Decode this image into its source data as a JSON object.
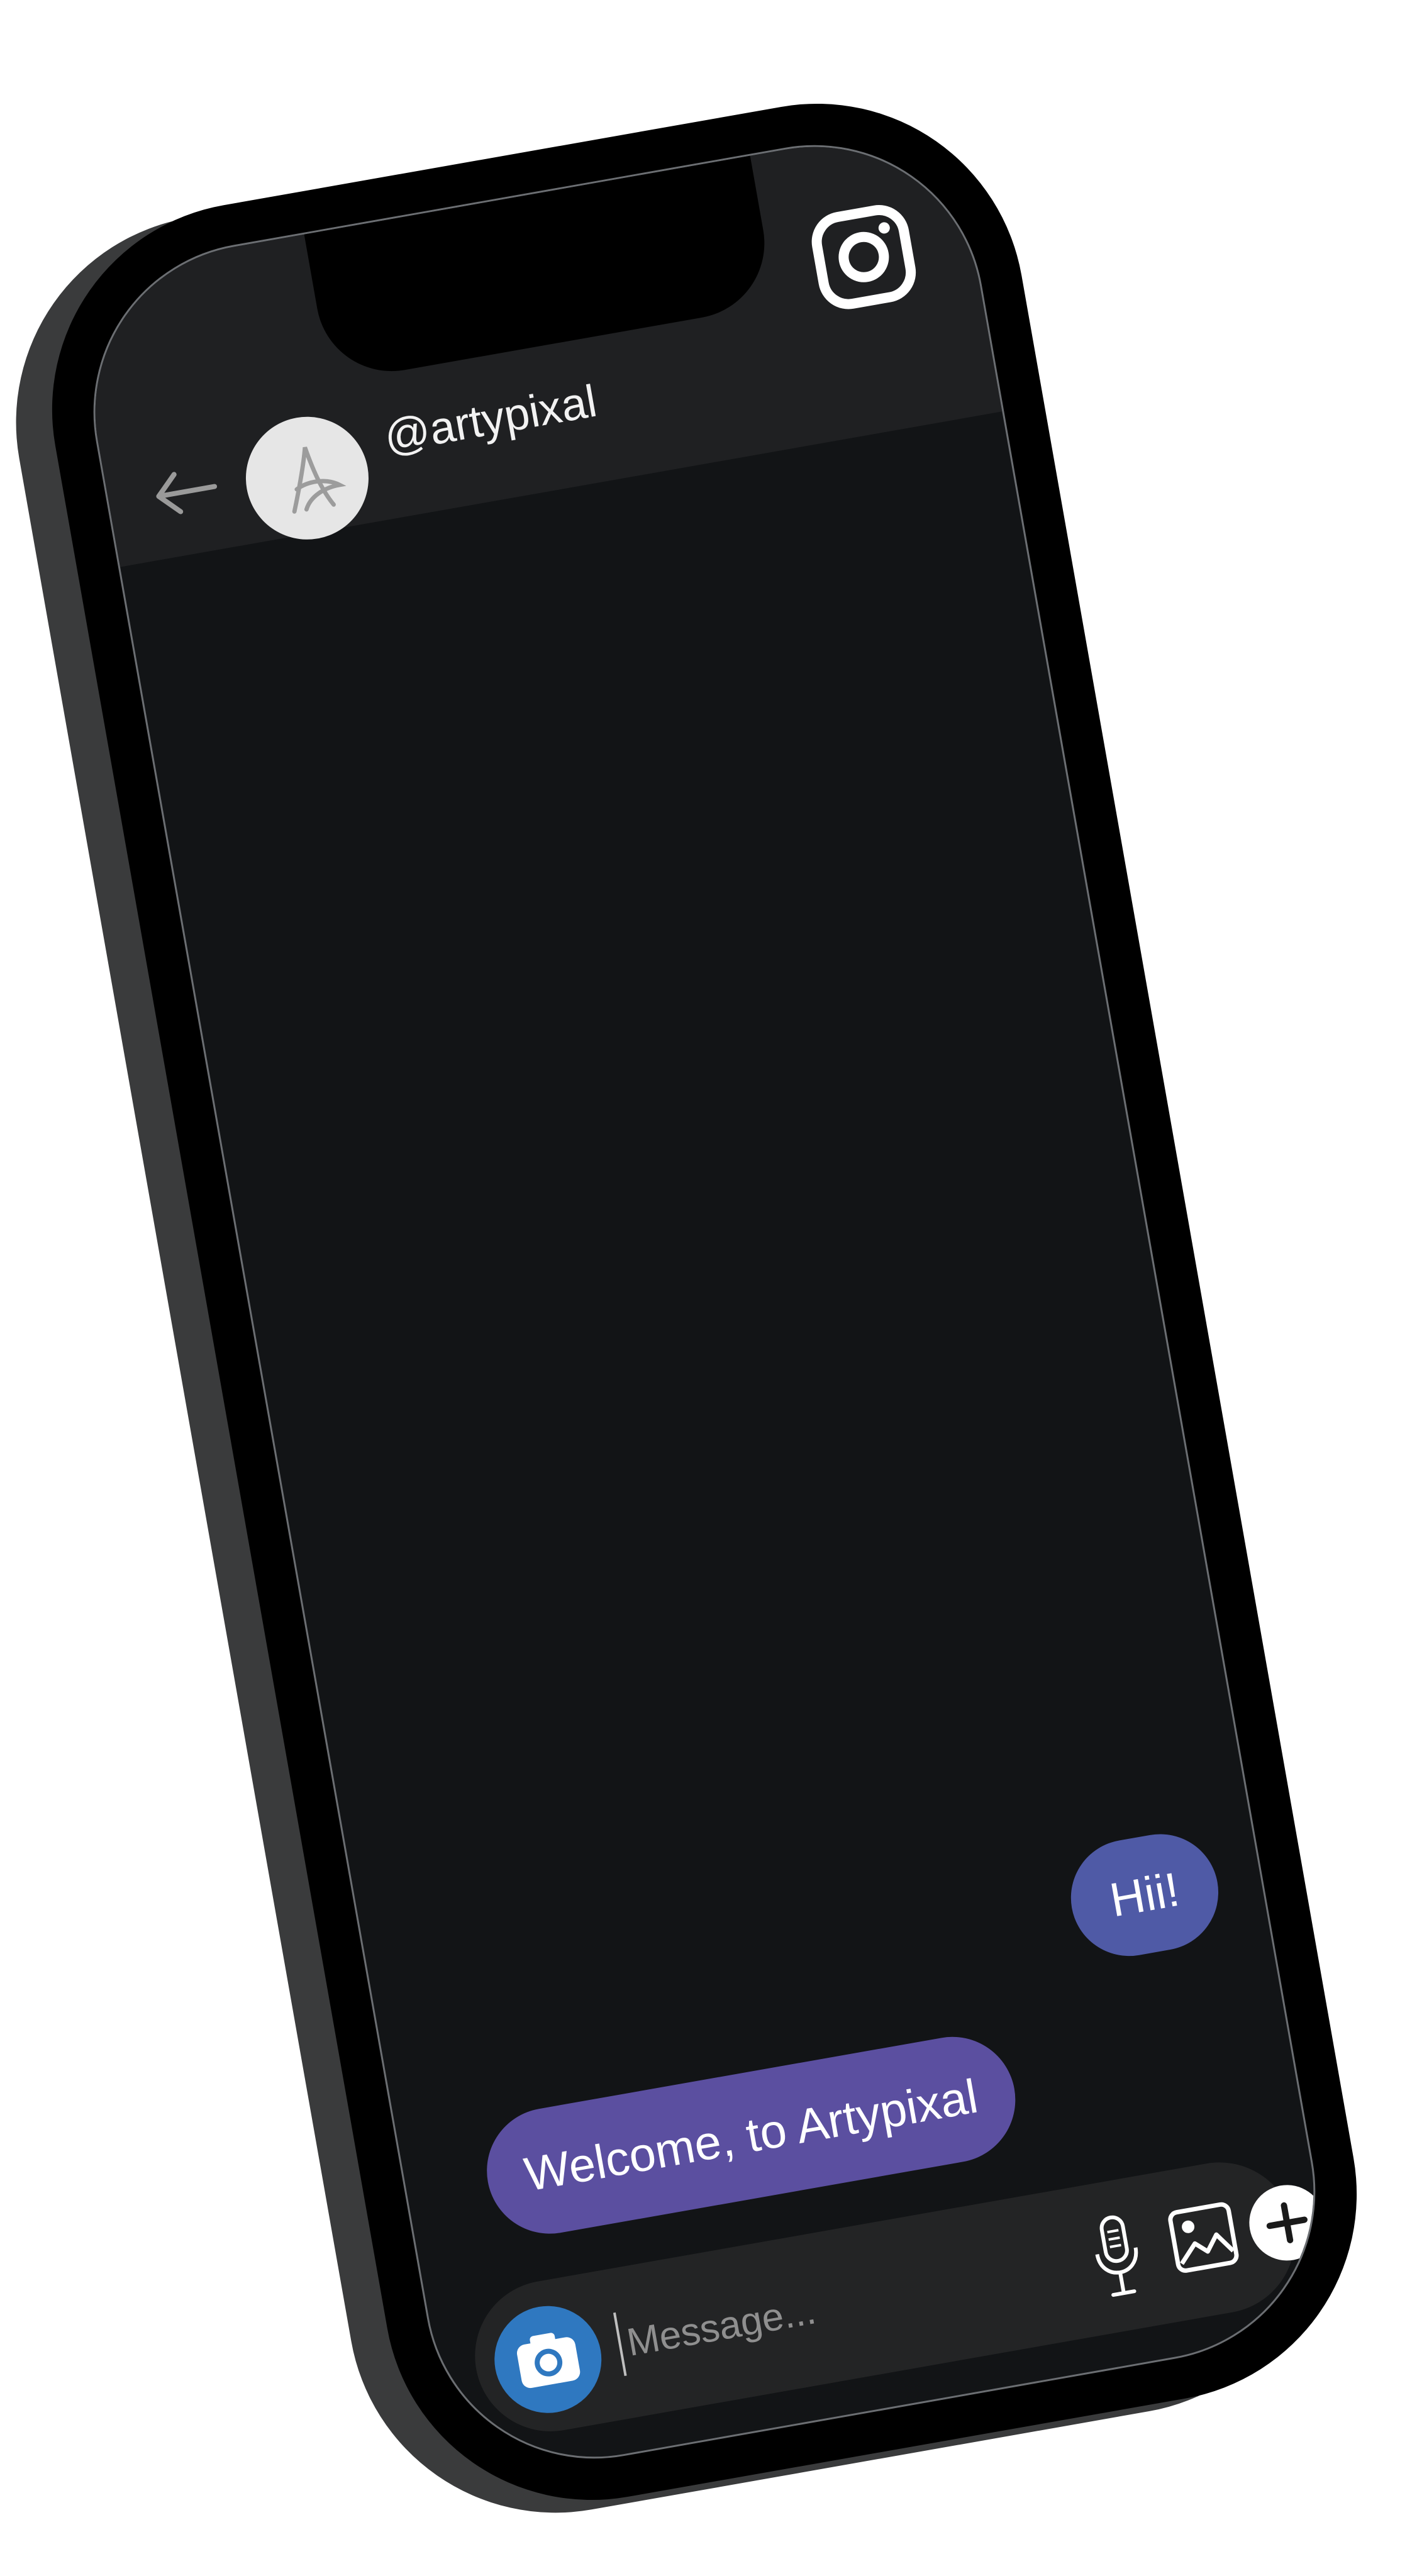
{
  "header": {
    "username": "@artypixal",
    "avatar_icon": "signature-a-avatar",
    "back_icon": "arrow-left-icon",
    "logo_icon": "instagram-logo-icon"
  },
  "messages": [
    {
      "direction": "outgoing",
      "text": "Hii!"
    },
    {
      "direction": "incoming",
      "text": "Welcome, to Artypixal"
    }
  ],
  "composer": {
    "placeholder": "Message...",
    "icons": [
      "camera-icon",
      "microphone-icon",
      "gallery-icon",
      "plus-icon"
    ]
  },
  "colors": {
    "screen_bg": "#121416",
    "header_bg": "#1f2022",
    "outgoing_bubble": "#4f5aa6",
    "incoming_bubble": "#5b4fa0",
    "camera_button": "#2f78c0",
    "composer_bg": "#232425"
  }
}
